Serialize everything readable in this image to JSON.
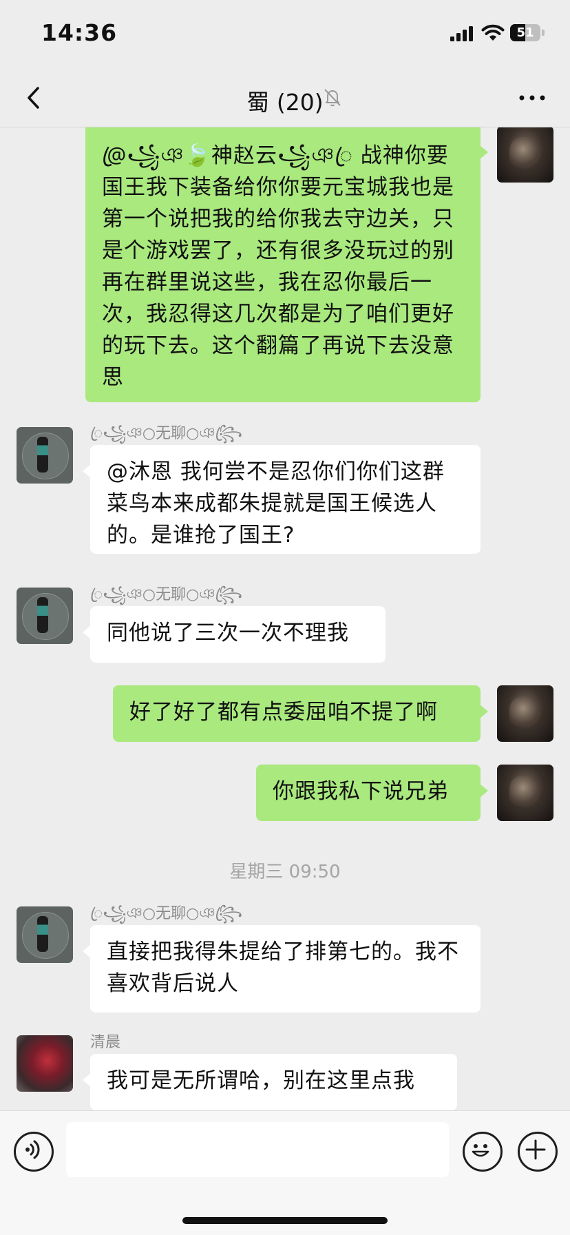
{
  "status": {
    "time": "14:36",
    "battery": "51",
    "battery_level": 0.51
  },
  "header": {
    "title": "蜀 (20)"
  },
  "messages": [
    {
      "side": "me",
      "text": "@ꦿ꧁ঞ🍃神赵云꧁ঞꦿ 战神你要国王我下装备给你你要元宝城我也是第一个说把我的给你我去守边关，只是个游戏罢了，还有很多没玩过的别再在群里说这些，我在忍你最后一次，我忍得这几次都是为了咱们更好的玩下去。这个翻篇了再说下去没意思"
    },
    {
      "side": "other",
      "sender": "ꦿ꧁ঞ○无聊○ঞ꧂ꦿ",
      "text": "@沐恩 我何尝不是忍你们你们这群菜鸟本来成都朱提就是国王候选人的。是谁抢了国王?"
    },
    {
      "side": "other",
      "sender": "ꦿ꧁ঞ○无聊○ঞ꧂ꦿ",
      "text": "同他说了三次一次不理我"
    },
    {
      "side": "me",
      "text": "好了好了都有点委屈咱不提了啊"
    },
    {
      "side": "me",
      "text": "你跟我私下说兄弟"
    },
    {
      "side": "other",
      "sender": "ꦿ꧁ঞ○无聊○ঞ꧂ꦿ",
      "text": "直接把我得朱提给了排第七的。我不喜欢背后说人"
    },
    {
      "side": "other",
      "sender": "清晨",
      "text": "我可是无所谓哈，别在这里点我"
    }
  ],
  "timestamp": "星期三 09:50",
  "input": {
    "value": "",
    "placeholder": ""
  },
  "colors": {
    "me_bubble": "#a9e97e",
    "other_bubble": "#ffffff",
    "background": "#ededed"
  },
  "icons": {
    "back": "chevron-left-icon",
    "mute": "bell-off-icon",
    "more": "more-dots-icon",
    "voice": "voice-icon",
    "emoji": "emoji-icon",
    "plus": "plus-icon"
  }
}
